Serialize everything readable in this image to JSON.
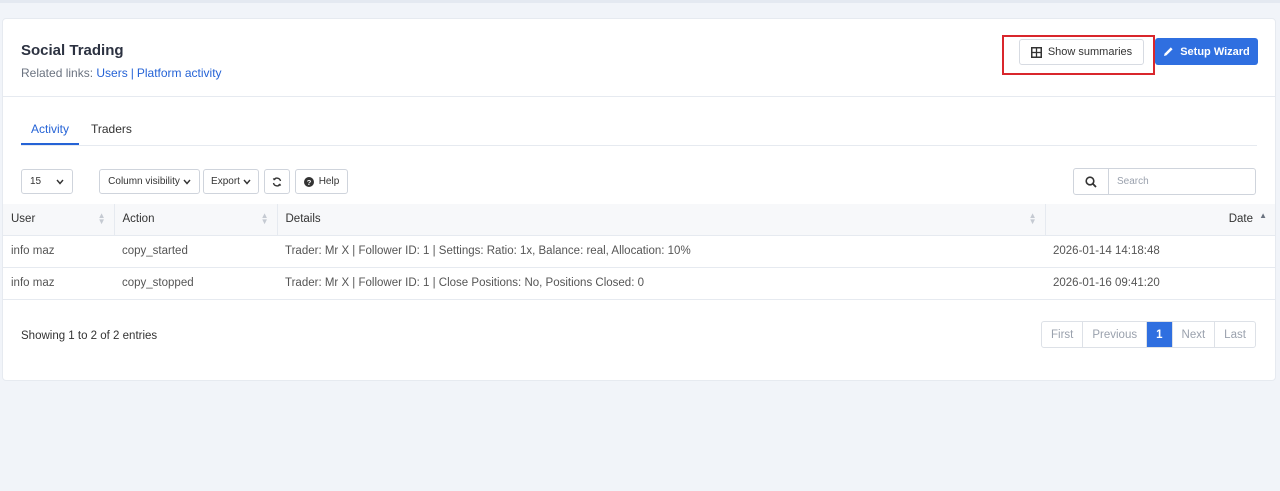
{
  "header": {
    "title": "Social Trading",
    "related_prefix": "Related links:",
    "related_links": [
      "Users",
      "Platform activity"
    ],
    "show_summaries": "Show summaries",
    "setup_wizard": "Setup Wizard"
  },
  "tabs": [
    {
      "label": "Activity",
      "active": true
    },
    {
      "label": "Traders",
      "active": false
    }
  ],
  "toolbar": {
    "page_length": "15",
    "column_visibility": "Column visibility",
    "export": "Export",
    "help": "Help",
    "search_placeholder": "Search"
  },
  "table": {
    "columns": [
      "User",
      "Action",
      "Details",
      "Date"
    ],
    "rows": [
      [
        "info maz",
        "copy_started",
        "Trader: Mr X | Follower ID: 1 | Settings: Ratio: 1x, Balance: real, Allocation: 10%",
        "2026-01-14 14:18:48"
      ],
      [
        "info maz",
        "copy_stopped",
        "Trader: Mr X | Follower ID: 1 | Close Positions: No, Positions Closed: 0",
        "2026-01-16 09:41:20"
      ]
    ]
  },
  "footer": {
    "showing": "Showing 1 to 2 of 2 entries",
    "pagination": [
      "First",
      "Previous",
      "1",
      "Next",
      "Last"
    ],
    "current_page": "1"
  },
  "colors": {
    "accent": "#2f6fe0",
    "highlight": "#d9262c"
  }
}
